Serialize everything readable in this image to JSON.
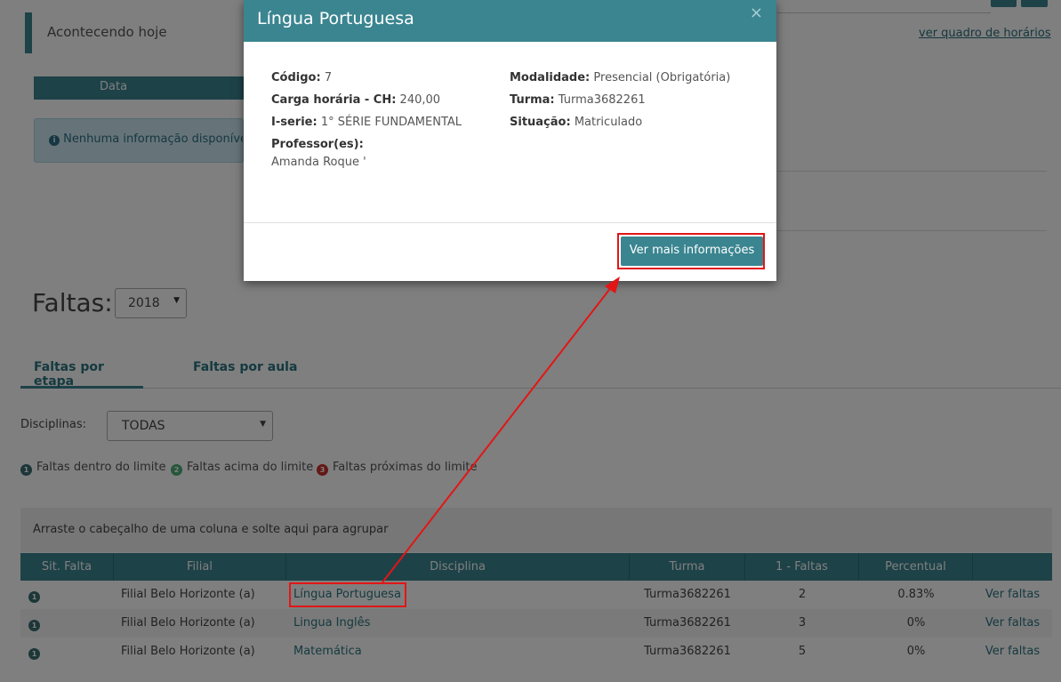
{
  "news": {
    "title": "Acontecendo hoje",
    "link": "ver quadro de horários",
    "column_header": "Data",
    "info": "Nenhuma informação disponível"
  },
  "faltas": {
    "title": "Faltas:",
    "year": "2018",
    "tabs": [
      "Faltas por etapa",
      "Faltas por aula"
    ],
    "disciplinas_label": "Disciplinas:",
    "disciplinas_value": "TODAS",
    "legend": [
      {
        "badge": "1",
        "label": "Faltas dentro do limite",
        "color": "#3a6e73"
      },
      {
        "badge": "2",
        "label": "Faltas acima do limite",
        "color": "#4caf77"
      },
      {
        "badge": "3",
        "label": "Faltas próximas do limite",
        "color": "#c9302c"
      }
    ]
  },
  "grid": {
    "group_hint": "Arraste o cabeçalho de uma coluna e solte aqui para agrupar",
    "columns": [
      "Sit. Falta",
      "Filial",
      "Disciplina",
      "Turma",
      "1 - Faltas",
      "Percentual",
      ""
    ],
    "rows": [
      {
        "badge": "1",
        "filial": "Filial Belo Horizonte (a)",
        "disciplina": "Língua Portuguesa",
        "turma": "Turma3682261",
        "faltas": "2",
        "percentual": "0.83%",
        "action": "Ver faltas"
      },
      {
        "badge": "1",
        "filial": "Filial Belo Horizonte (a)",
        "disciplina": "Lingua Inglês",
        "turma": "Turma3682261",
        "faltas": "3",
        "percentual": "0%",
        "action": "Ver faltas"
      },
      {
        "badge": "1",
        "filial": "Filial Belo Horizonte (a)",
        "disciplina": "Matemática",
        "turma": "Turma3682261",
        "faltas": "5",
        "percentual": "0%",
        "action": "Ver faltas"
      }
    ]
  },
  "modal": {
    "title": "Língua Portuguesa",
    "close": "×",
    "codigo_label": "Código:",
    "codigo": "7",
    "carga_label": "Carga horária - CH:",
    "carga": "240,00",
    "serie_label": "I-serie:",
    "serie": "1° SÉRIE FUNDAMENTAL",
    "professor_label": "Professor(es):",
    "professor": "Amanda Roque '",
    "modalidade_label": "Modalidade:",
    "modalidade": "Presencial (Obrigatória)",
    "turma_label": "Turma:",
    "turma": "Turma3682261",
    "situacao_label": "Situação:",
    "situacao": "Matriculado",
    "button": "Ver mais informações"
  },
  "colors": {
    "accent": "#3a8590",
    "annotation": "#e21616"
  }
}
